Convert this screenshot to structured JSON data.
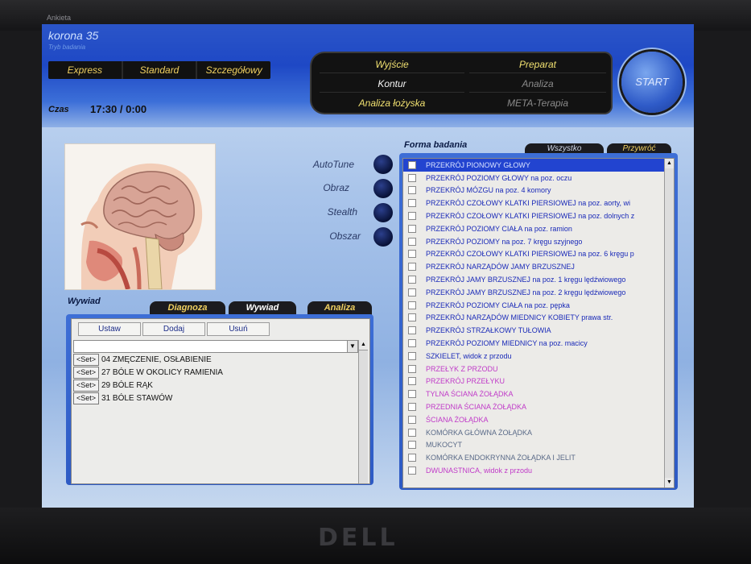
{
  "window": {
    "title": "Ankieta"
  },
  "header": {
    "app_title": "korona 35",
    "app_subtitle": "Tryb badania",
    "modes": [
      "Express",
      "Standard",
      "Szczegółowy"
    ],
    "czas_label": "Czas",
    "czas_value": "17:30 / 0:00"
  },
  "commands": {
    "left": [
      "Wyjście",
      "Kontur",
      "Analiza łożyska"
    ],
    "right": [
      "Preparat",
      "Analiza",
      "META-Terapia"
    ],
    "start": "START"
  },
  "options": [
    "AutoTune",
    "Obraz",
    "Stealth",
    "Obszar"
  ],
  "left_panel": {
    "section_label": "Wywiad",
    "tabs": [
      "Diagnoza",
      "Wywiad",
      "Analiza"
    ],
    "buttons": [
      "Ustaw",
      "Dodaj",
      "Usuń"
    ],
    "combo_value": "",
    "set_label": "<Set>",
    "items": [
      "04 ZMĘCZENIE, OSŁABIENIE",
      "27 BÓLE W OKOLICY RAMIENIA",
      "29 BÓLE RĄK",
      "31 BÓLE STAWÓW"
    ]
  },
  "right_panel": {
    "section_label": "Forma badania",
    "tabs": [
      "Wszystko",
      "Przywróć"
    ],
    "items": [
      {
        "text": "PRZEKRÓJ PIONOWY GŁOWY",
        "color": "#d9e3ff",
        "selected": true
      },
      {
        "text": "PRZEKRÓJ POZIOMY GŁOWY na poz. oczu",
        "color": "#1a2ab8"
      },
      {
        "text": "PRZEKRÓJ MÓZGU na poz. 4 komory",
        "color": "#1a2ab8"
      },
      {
        "text": "PRZEKRÓJ CZOŁOWY KLATKI PIERSIOWEJ na poz. aorty, wi",
        "color": "#1a2ab8"
      },
      {
        "text": "PRZEKRÓJ CZOŁOWY KLATKI PIERSIOWEJ na poz. dolnych z",
        "color": "#1a2ab8"
      },
      {
        "text": "PRZEKRÓJ POZIOMY CIAŁA na poz. ramion",
        "color": "#1a2ab8"
      },
      {
        "text": "PRZEKRÓJ POZIOMY na poz. 7 kręgu szyjnego",
        "color": "#1a2ab8"
      },
      {
        "text": "PRZEKRÓJ CZOŁOWY KLATKI PIERSIOWEJ na poz. 6 kręgu p",
        "color": "#1a2ab8"
      },
      {
        "text": "PRZEKRÓJ NARZĄDÓW JAMY BRZUSZNEJ",
        "color": "#1a2ab8"
      },
      {
        "text": "PRZEKRÓJ JAMY BRZUSZNEJ na poz. 1 kręgu lędźwiowego",
        "color": "#1a2ab8"
      },
      {
        "text": "PRZEKRÓJ JAMY BRZUSZNEJ na poz. 2 kręgu lędźwiowego",
        "color": "#1a2ab8"
      },
      {
        "text": "PRZEKRÓJ POZIOMY CIAŁA na poz. pępka",
        "color": "#1a2ab8"
      },
      {
        "text": "PRZEKRÓJ NARZĄDÓW MIEDNICY KOBIETY prawa str.",
        "color": "#1a2ab8"
      },
      {
        "text": "PRZEKRÓJ STRZAŁKOWY TUŁOWIA",
        "color": "#1a2ab8"
      },
      {
        "text": "PRZEKRÓJ POZIOMY MIEDNICY na poz. macicy",
        "color": "#1a2ab8"
      },
      {
        "text": "SZKIELET, widok z przodu",
        "color": "#1a2ab8"
      },
      {
        "text": "PRZEŁYK Z PRZODU",
        "color": "#c03ac8"
      },
      {
        "text": "PRZEKRÓJ PRZEŁYKU",
        "color": "#c03ac8"
      },
      {
        "text": "TYLNA ŚCIANA ŻOŁĄDKA",
        "color": "#c03ac8"
      },
      {
        "text": "PRZEDNIA ŚCIANA ŻOŁĄDKA",
        "color": "#c03ac8"
      },
      {
        "text": "ŚCIANA ŻOŁĄDKA",
        "color": "#c03ac8"
      },
      {
        "text": "KOMÓRKA GŁÓWNA ŻOŁĄDKA",
        "color": "#5a6a88"
      },
      {
        "text": "MUKOCYT",
        "color": "#5a6a88"
      },
      {
        "text": "KOMÓRKA ENDOKRYNNA ŻOŁĄDKA I JELIT",
        "color": "#5a6a88"
      },
      {
        "text": "DWUNASTNICA, widok z przodu",
        "color": "#c03ac8"
      }
    ]
  },
  "footer": {
    "brand": "DELL"
  }
}
